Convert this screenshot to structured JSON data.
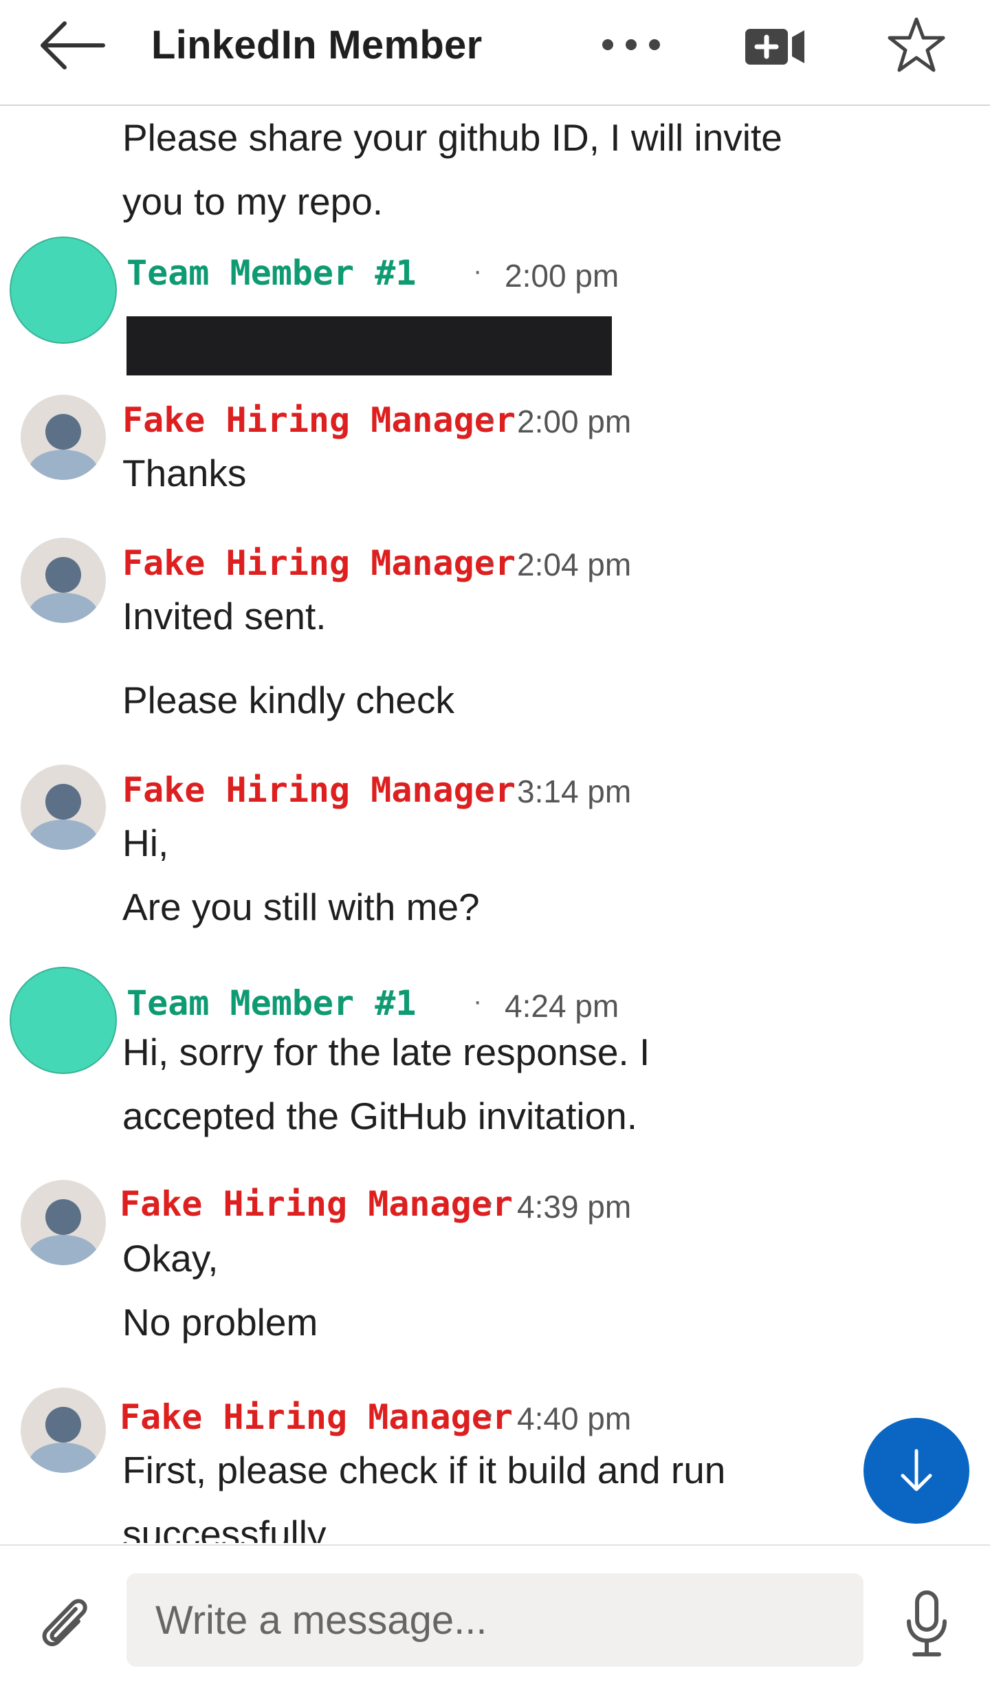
{
  "header": {
    "title": "LinkedIn Member",
    "icons": [
      "back-arrow-icon",
      "more-options-icon",
      "video-call-icon",
      "star-icon"
    ]
  },
  "messages": [
    {
      "lines": [
        "Please share your github ID, I will invite",
        "you to my repo."
      ]
    },
    {
      "sender": "Team Member #1",
      "time": "2:00 pm",
      "redacted": true
    },
    {
      "sender": "Fake Hiring Manager",
      "time": "2:00 pm",
      "lines": [
        "Thanks"
      ]
    },
    {
      "sender": "Fake Hiring Manager",
      "time": "2:04 pm",
      "lines": [
        "Invited sent.",
        "Please kindly check"
      ]
    },
    {
      "sender": "Fake Hiring Manager",
      "time": "3:14 pm",
      "lines": [
        "Hi,",
        "Are you still with me?"
      ]
    },
    {
      "sender": "Team Member #1",
      "time": "4:24 pm",
      "lines": [
        "Hi, sorry for the late response. I",
        "accepted the GitHub invitation."
      ]
    },
    {
      "sender": "Fake Hiring Manager",
      "time": "4:39 pm",
      "lines": [
        "Okay,",
        "No problem"
      ]
    },
    {
      "sender": "Fake Hiring Manager",
      "time": "4:40 pm",
      "lines": [
        "First, please check if it build and run",
        "successfully"
      ]
    }
  ],
  "separator": "·",
  "composer": {
    "placeholder": "Write a message...",
    "value": ""
  },
  "colors": {
    "team_member_name": "#0e9a72",
    "team_member_avatar": "#45d8b6",
    "fake_manager_name": "#dd1f1f",
    "scroll_button": "#0a66c2",
    "redaction": "#1d1d1f"
  }
}
